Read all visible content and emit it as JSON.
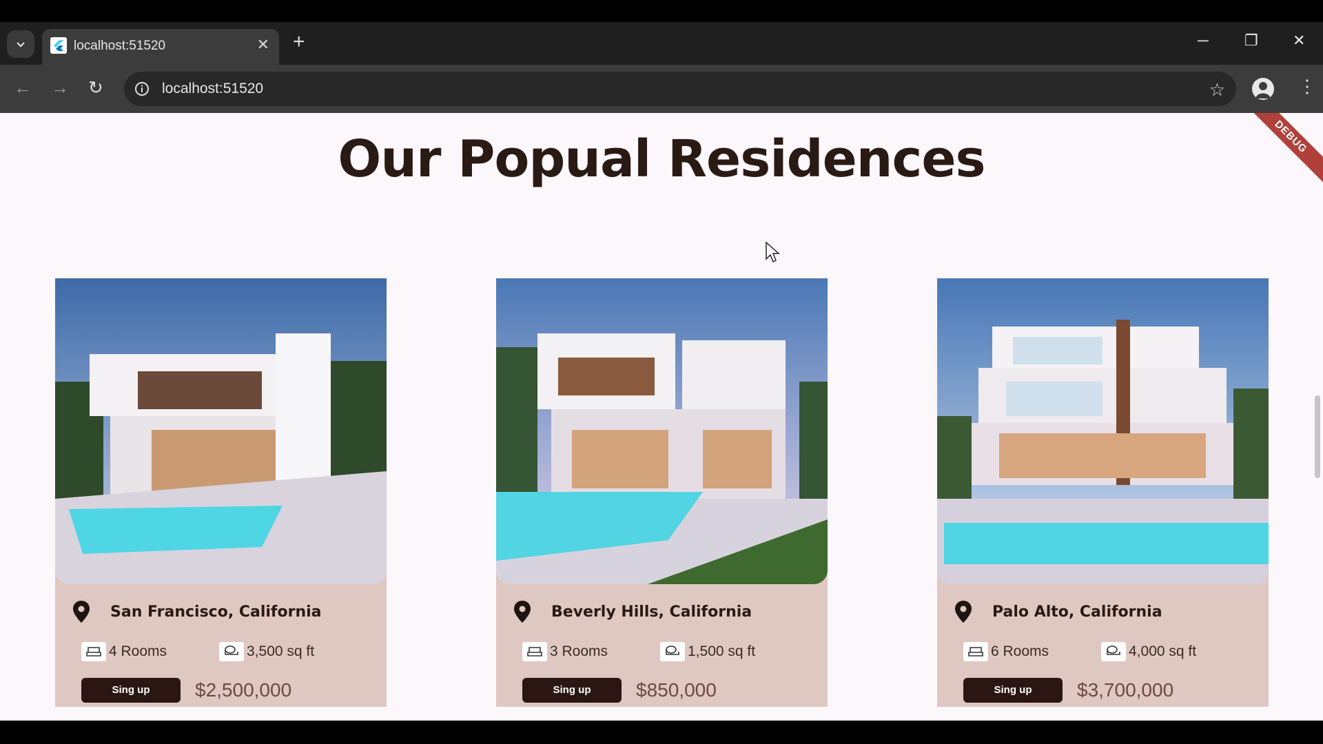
{
  "browser": {
    "tab_title": "localhost:51520",
    "url": "localhost:51520"
  },
  "page": {
    "heading": "Our Popual Residences",
    "debug_banner": "DEBUG"
  },
  "cards": [
    {
      "location": "San Francisco, California",
      "rooms": "4 Rooms",
      "area": "3,500 sq ft",
      "button": "Sing up",
      "price": "$2,500,000"
    },
    {
      "location": "Beverly Hills, California",
      "rooms": "3 Rooms",
      "area": "1,500 sq ft",
      "button": "Sing up",
      "price": "$850,000"
    },
    {
      "location": "Palo Alto, California",
      "rooms": "6 Rooms",
      "area": "4,000 sq ft",
      "button": "Sing up",
      "price": "$3,700,000"
    }
  ],
  "icons": {
    "location": "map-pin-icon",
    "rooms": "bed-icon",
    "area": "ruler-icon"
  },
  "colors": {
    "card_bg": "#dfc8c1",
    "button_bg": "#2a1714",
    "heading": "#2a1a14",
    "page_bg": "#fcf7fb"
  }
}
